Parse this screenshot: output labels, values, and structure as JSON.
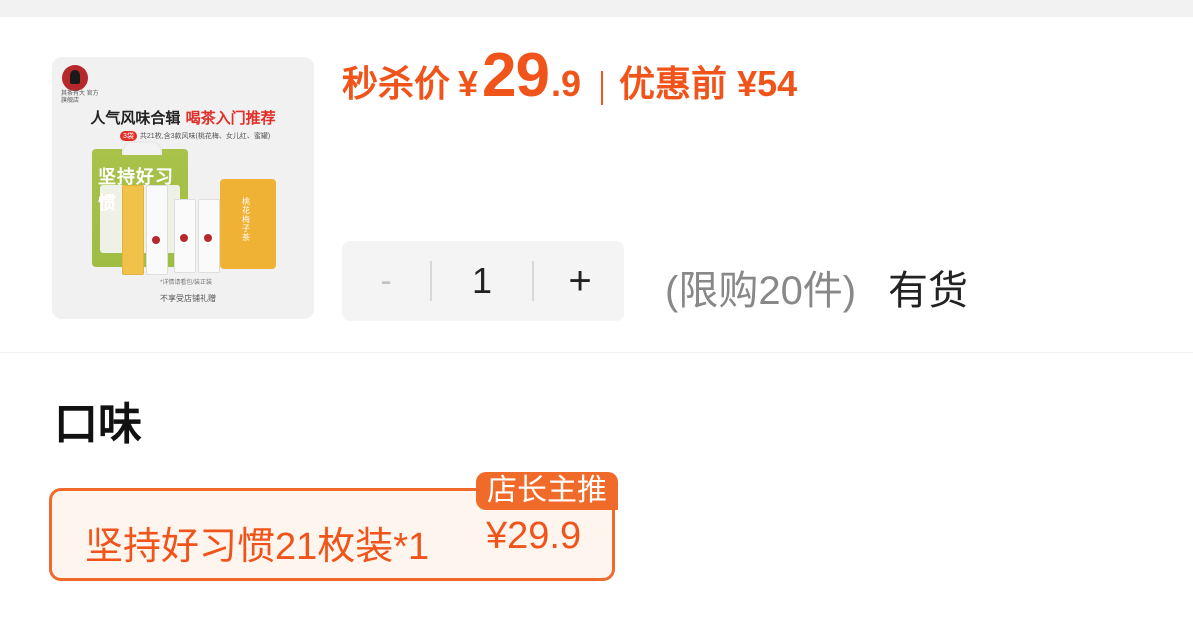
{
  "product": {
    "image": {
      "brand_logo_text": "其茶有大 官方旗舰店",
      "headline_prefix": "人气风味合辑 ",
      "headline_highlight": "喝茶入门推荐",
      "badge": "3袋",
      "subline": "共21枚,含3款风味(桃花梅、女儿红、蜜罐)",
      "pack_title": "坚持好习惯",
      "pack2_text": "桃花梅子茶",
      "foot_small": "*详情请看包/装正装",
      "foot_note": "不享受店铺礼赠"
    },
    "price": {
      "label": "秒杀价",
      "currency": "¥",
      "integer": "29",
      "decimal": ".9",
      "original_label": "优惠前",
      "original_value": "¥54"
    },
    "quantity": {
      "minus": "-",
      "value": "1",
      "plus": "+",
      "limit_text": "(限购20件)",
      "stock_text": "有货"
    }
  },
  "options": {
    "section_title": "口味",
    "items": [
      {
        "tag": "店长主推",
        "name": "坚持好习惯21枚装*1",
        "price": "¥29.9",
        "selected": true
      }
    ]
  },
  "colors": {
    "accent": "#f0541a",
    "accent_border": "#f16a2c",
    "selected_bg": "#fff5ef",
    "muted_text": "#888888"
  }
}
